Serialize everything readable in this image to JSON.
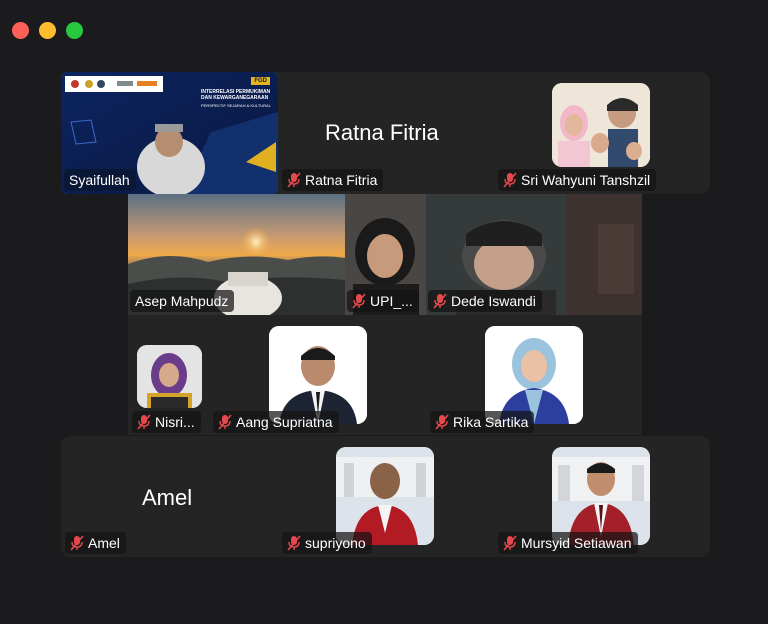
{
  "window": {
    "controls": [
      "close",
      "minimize",
      "zoom"
    ]
  },
  "slide": {
    "tag": "FGD",
    "title_line1": "INTERRELASI PERMUKIMAN",
    "title_line2": "DAN KEWARGANEGARAAN",
    "subtitle": "PERSPEKTIF SEJARAH & KULTURAL"
  },
  "participants": [
    {
      "id": "syaifullah",
      "label": "Syaifullah",
      "muted": false,
      "active_speaker": true
    },
    {
      "id": "ratna",
      "label": "Ratna Fitria",
      "display_name": "Ratna Fitria",
      "muted": true
    },
    {
      "id": "sri",
      "label": "Sri Wahyuni Tanshzil",
      "muted": true
    },
    {
      "id": "asep",
      "label": "Asep Mahpudz",
      "muted": false
    },
    {
      "id": "upi",
      "label": "UPI_...",
      "muted": true
    },
    {
      "id": "dede",
      "label": "Dede Iswandi",
      "muted": true
    },
    {
      "id": "nisri",
      "label": "Nisri...",
      "muted": true
    },
    {
      "id": "aang",
      "label": "Aang Supriatna",
      "muted": true
    },
    {
      "id": "rika",
      "label": "Rika Sartika",
      "muted": true
    },
    {
      "id": "amel",
      "label": "Amel",
      "display_name": "Amel",
      "muted": true
    },
    {
      "id": "supriyono",
      "label": "supriyono",
      "muted": true
    },
    {
      "id": "mursyid",
      "label": "Mursyid Setiawan",
      "muted": true
    }
  ],
  "colors": {
    "active_border": "#43d64b",
    "muted_icon": "#e5484d",
    "tile_bg": "#242424",
    "window_bg": "#1b1b1d"
  }
}
